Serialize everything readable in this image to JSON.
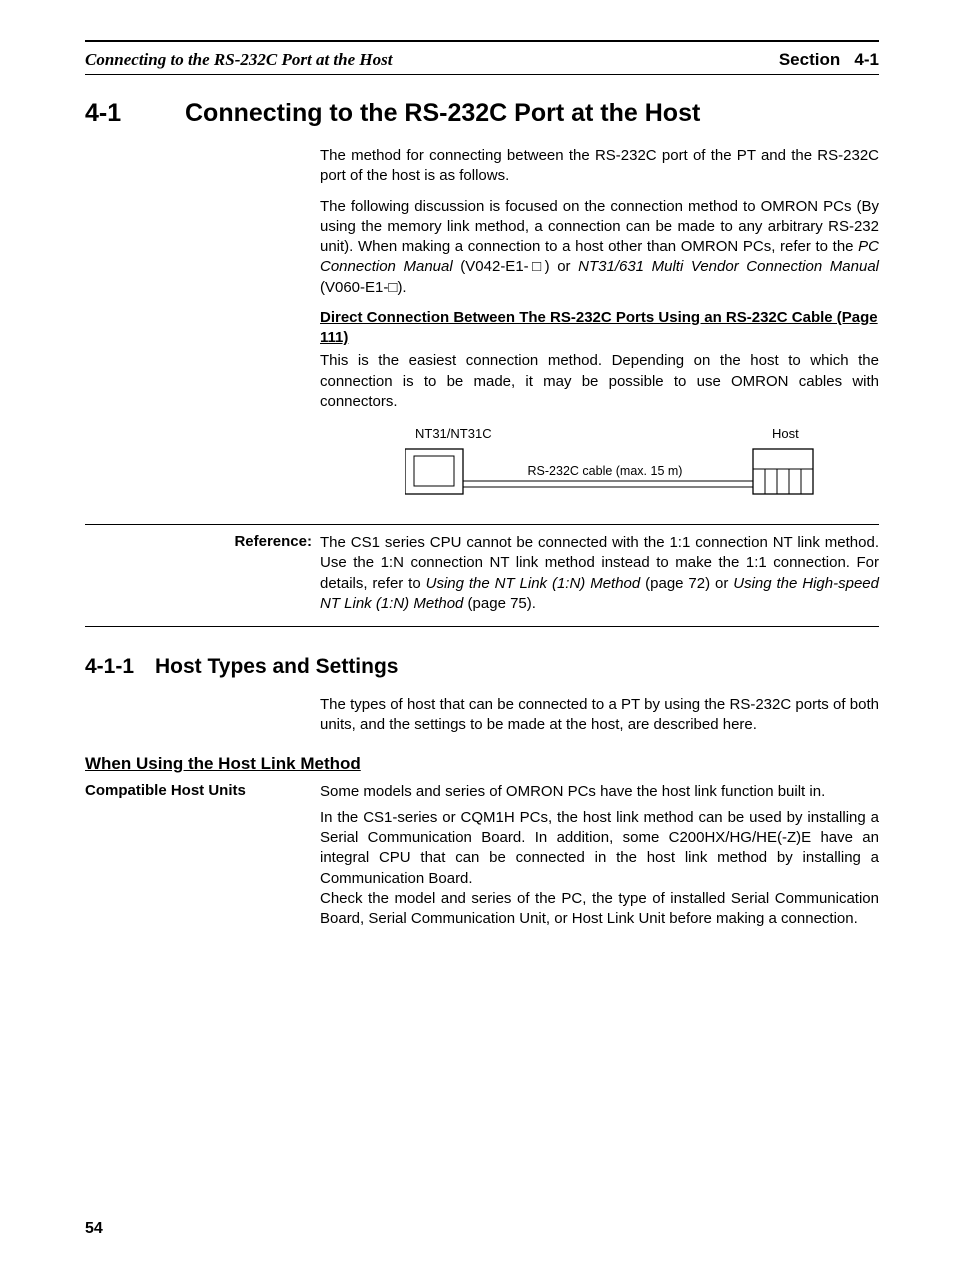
{
  "header": {
    "left": "Connecting to the RS-232C Port at the Host",
    "section_label": "Section",
    "section_num": "4-1"
  },
  "section": {
    "num": "4-1",
    "title": "Connecting to the RS-232C Port at the Host"
  },
  "para1": "The method for connecting between the RS-232C port of the PT and the RS-232C port of the host is as follows.",
  "para2_a": "The following discussion is focused on the connection method to OMRON PCs (By using the memory link method, a connection can be made to any arbitrary RS-232 unit). When making a connection to a host other than OMRON PCs, refer to the ",
  "para2_b": "PC Connection Manual",
  "para2_c": " (V042-E1-",
  "para2_d": ") or ",
  "para2_e": "NT31/631 Multi Vendor Connection Manual",
  "para2_f": " (V060-E1-",
  "para2_g": ").",
  "link_heading": "Direct Connection Between The RS-232C Ports Using an RS-232C Cable (Page 111)",
  "para3": "This is the easiest connection method. Depending on the host to which the connection is to be made, it may be possible to use OMRON cables with connectors.",
  "diagram": {
    "left_label": "NT31/NT31C",
    "right_label": "Host",
    "cable_label": "RS-232C cable (max. 15 m)"
  },
  "reference": {
    "label": "Reference:",
    "text_a": "The CS1 series CPU cannot be connected with the 1:1 connection NT link method. Use the 1:N connection NT link method instead to make the 1:1 connection. For details, refer to ",
    "text_b": "Using the NT Link (1:N) Method",
    "text_c": " (page 72) or ",
    "text_d": "Using the High-speed NT Link (1:N) Method",
    "text_e": " (page 75)."
  },
  "subsection": {
    "num": "4-1-1",
    "title": "Host Types and Settings"
  },
  "para4": "The types of host that can be connected to a PT by using the RS-232C ports of both units, and the settings to be made at the host, are described here.",
  "subheading": "When Using the Host Link Method",
  "side_label": "Compatible Host Units",
  "para5": "Some models and series of OMRON PCs have the host link function built in.",
  "para6": "In the CS1-series or CQM1H PCs, the host link method can be used by installing a Serial Communication Board. In addition, some C200HX/HG/HE(-Z)E have an integral CPU that can be connected in the host link method by installing a Communication Board.",
  "para7": "Check the model and series of the PC, the type of installed Serial Communication Board, Serial Communication Unit, or Host Link Unit before making a connection.",
  "page_num": "54"
}
